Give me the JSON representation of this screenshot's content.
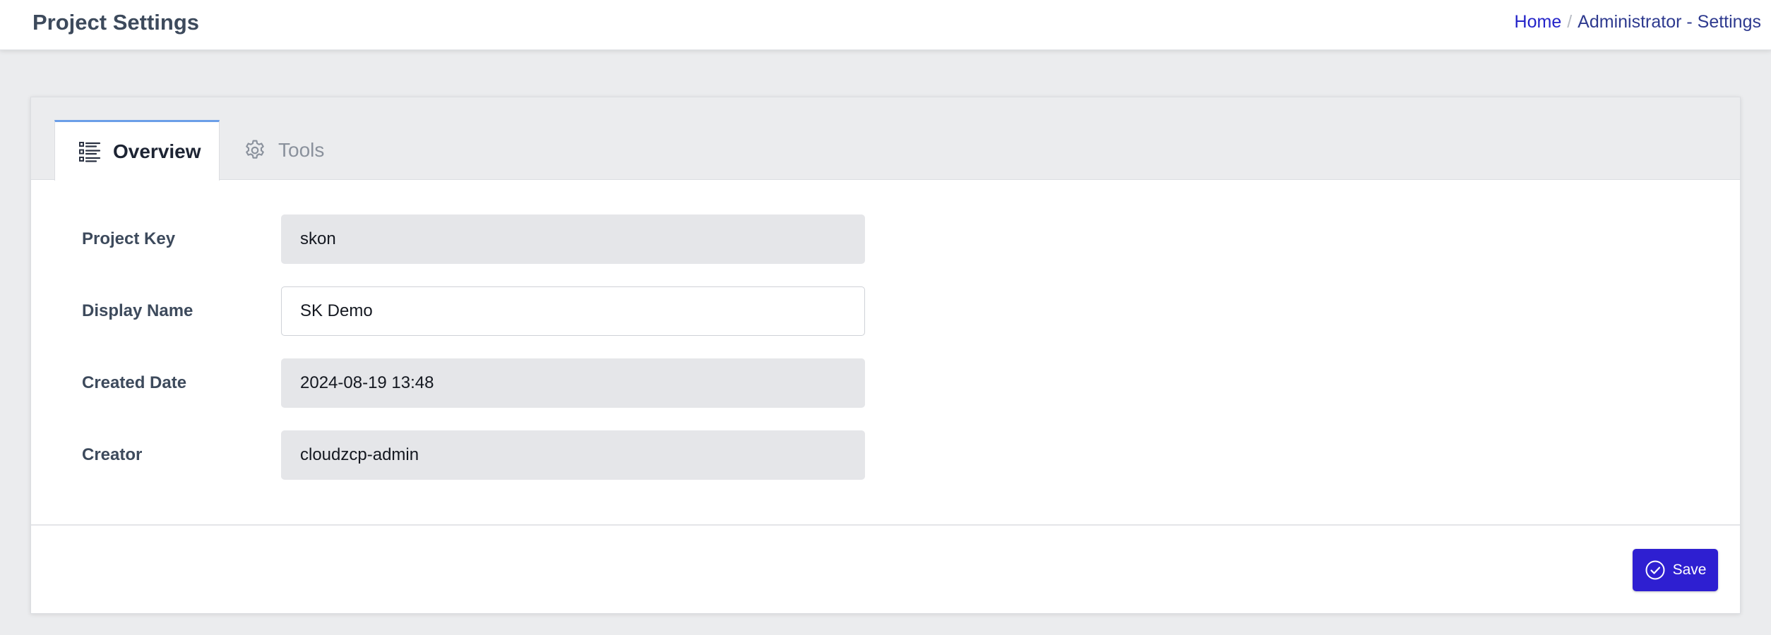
{
  "header": {
    "title": "Project Settings",
    "breadcrumb": {
      "home": "Home",
      "separator": "/",
      "current": "Administrator - Settings"
    }
  },
  "tabs": [
    {
      "label": "Overview",
      "icon": "list-icon",
      "active": true
    },
    {
      "label": "Tools",
      "icon": "gear-icon",
      "active": false
    }
  ],
  "form": {
    "fields": [
      {
        "label": "Project Key",
        "value": "skon",
        "editable": false
      },
      {
        "label": "Display Name",
        "value": "SK Demo",
        "editable": true
      },
      {
        "label": "Created Date",
        "value": "2024-08-19 13:48",
        "editable": false
      },
      {
        "label": "Creator",
        "value": "cloudzcp-admin",
        "editable": false
      }
    ]
  },
  "footer": {
    "save_label": "Save",
    "save_icon": "check-circle-icon"
  },
  "colors": {
    "accent": "#2e1fd1",
    "link": "#2424c9",
    "active_tab_border": "#6b9ee8",
    "readonly_field_bg": "#e5e6e9"
  }
}
